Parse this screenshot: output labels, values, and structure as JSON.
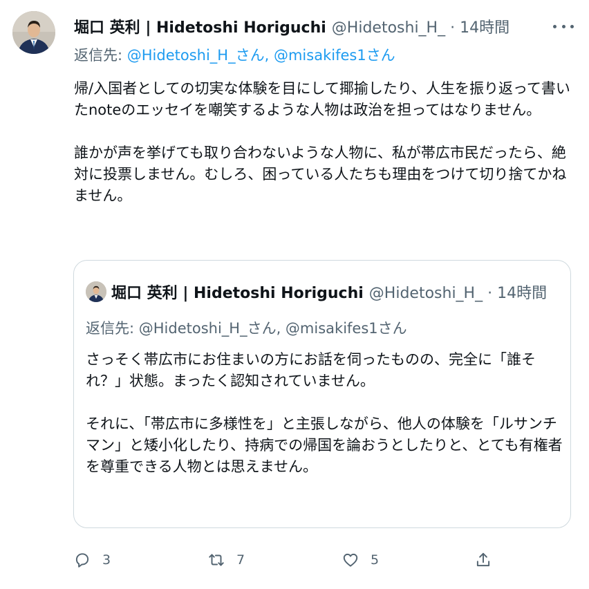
{
  "tweet": {
    "author_name": "堀口 英利 | Hidetoshi Horiguchi",
    "handle_time": "@Hidetoshi_H_ · 14時間",
    "replying_prefix": "返信先: ",
    "mention_1": "@Hidetoshi_H_",
    "mention_sep": "さん, ",
    "mention_2": "@misakifes1",
    "mention_suffix": "さん",
    "paragraphs": [
      "帰/入国者としての切実な体験を目にして揶揄したり、人生を振り返って書いたnoteのエッセイを嘲笑するような人物は政治を担ってはなりません。",
      "誰かが声を挙げても取り合わないような人物に、私が帯広市民だったら、絶対に投票しません。むしろ、困っている人たちも理由をつけて切り捨てかねません。"
    ]
  },
  "quoted": {
    "author_name": "堀口 英利 | Hidetoshi Horiguchi",
    "handle_time": "@Hidetoshi_H_ · 14時間",
    "replying": "返信先: @Hidetoshi_H_さん, @misakifes1さん",
    "paragraphs": [
      "さっそく帯広市にお住まいの方にお話を伺ったものの、完全に「誰それ？」状態。まったく認知されていません。",
      "それに、「帯広市に多様性を」と主張しながら、他人の体験を「ルサンチマン」と矮小化したり、持病での帰国を論おうとしたりと、とても有権者を尊重できる人物とは思えません。"
    ]
  },
  "actions": {
    "reply_count": "3",
    "retweet_count": "7",
    "like_count": "5"
  },
  "icons": {
    "more": "more-icon",
    "reply": "reply-icon",
    "retweet": "retweet-icon",
    "like": "like-icon",
    "share": "share-icon"
  }
}
